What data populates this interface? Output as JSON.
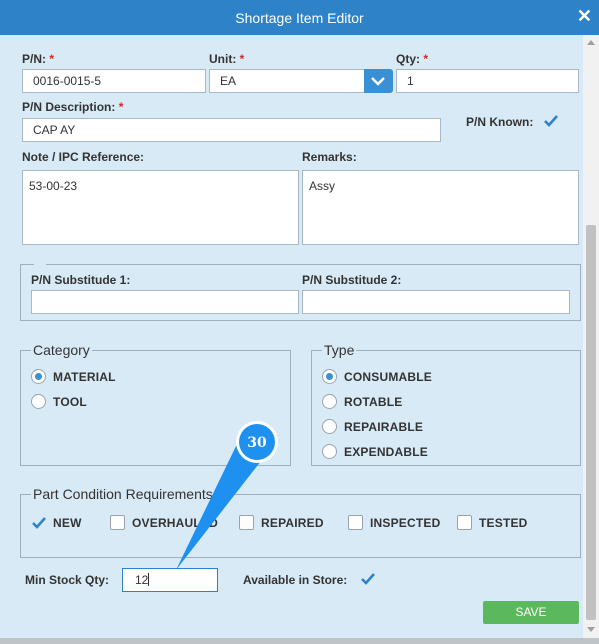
{
  "window": {
    "title": "Shortage Item Editor"
  },
  "form": {
    "pn": {
      "label": "P/N:",
      "required": "*",
      "value": "0016-0015-5"
    },
    "unit": {
      "label": "Unit:",
      "required": "*",
      "value": "EA"
    },
    "qty": {
      "label": "Qty:",
      "required": "*",
      "value": "1"
    },
    "pn_description": {
      "label": "P/N Description:",
      "required": "*",
      "value": "CAP AY"
    },
    "pn_known": {
      "label": "P/N Known:",
      "checked": true
    },
    "note": {
      "label": "Note / IPC Reference:",
      "value": "53-00-23"
    },
    "remarks": {
      "label": "Remarks:",
      "value": "Assy"
    },
    "substitute1": {
      "label": "P/N Substitude 1:",
      "value": ""
    },
    "substitute2": {
      "label": "P/N Substitude 2:",
      "value": ""
    },
    "category": {
      "legend": "Category",
      "options": [
        {
          "label": "MATERIAL",
          "selected": true
        },
        {
          "label": "TOOL",
          "selected": false
        }
      ]
    },
    "type": {
      "legend": "Type",
      "options": [
        {
          "label": "CONSUMABLE",
          "selected": true
        },
        {
          "label": "ROTABLE",
          "selected": false
        },
        {
          "label": "REPAIRABLE",
          "selected": false
        },
        {
          "label": "EXPENDABLE",
          "selected": false
        }
      ]
    },
    "part_condition": {
      "legend": "Part Condition Requirements",
      "options": [
        {
          "label": "NEW",
          "checked": true
        },
        {
          "label": "OVERHAULED",
          "checked": false
        },
        {
          "label": "REPAIRED",
          "checked": false
        },
        {
          "label": "INSPECTED",
          "checked": false
        },
        {
          "label": "TESTED",
          "checked": false
        }
      ]
    },
    "min_stock": {
      "label": "Min Stock Qty:",
      "value": "12"
    },
    "available_in_store": {
      "label": "Available in Store:",
      "checked": true
    },
    "save_label": "SAVE"
  },
  "annotation": {
    "step": "30"
  },
  "colors": {
    "header": "#2d82c8",
    "background": "#d8eaf6",
    "accent": "#3a90d4",
    "required": "#d9261c",
    "save": "#5cb85c",
    "badge": "#1e90f0"
  },
  "icons": {
    "close": "close-icon",
    "dropdown": "chevron-down-icon",
    "checkmark": "checkmark-icon"
  }
}
